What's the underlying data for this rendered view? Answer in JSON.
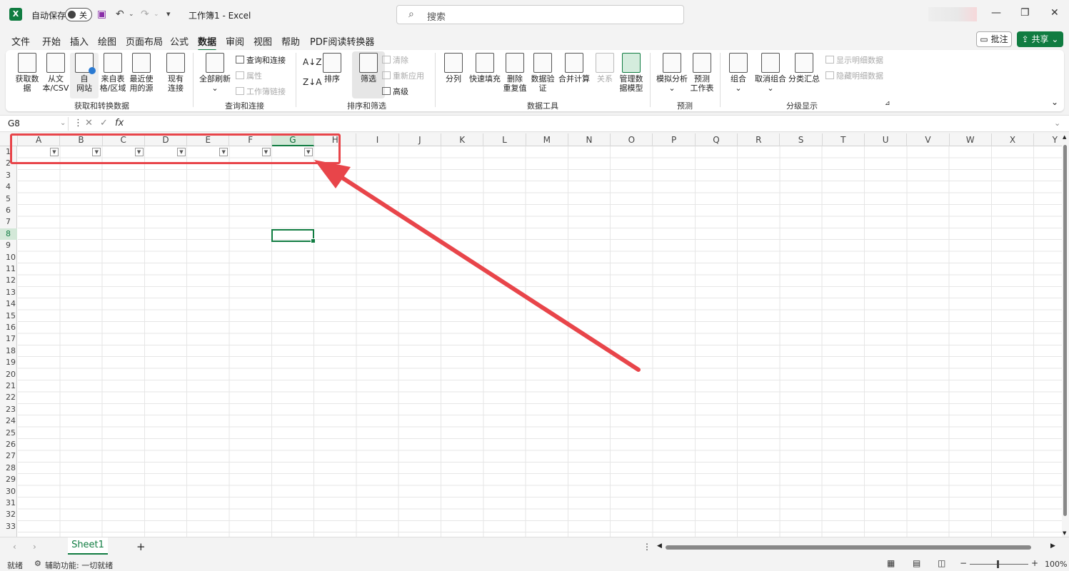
{
  "titlebar": {
    "app_logo": "X",
    "autosave_label": "自动保存",
    "autosave_state": "关",
    "doc_title": "工作簿1  -  Excel",
    "search_placeholder": "搜索",
    "icons": [
      "save-icon",
      "undo-icon",
      "redo-icon",
      "customize-icon",
      "search-icon",
      "minimize-icon",
      "restore-icon",
      "close-icon"
    ]
  },
  "menu": [
    "文件",
    "开始",
    "插入",
    "绘图",
    "页面布局",
    "公式",
    "数据",
    "审阅",
    "视图",
    "帮助",
    "PDF阅读转换器"
  ],
  "menu_active": "数据",
  "comment_label": "批注",
  "share_label": "共享",
  "ribbon": {
    "get_data": "获取数\n据",
    "from_csv": "从文\n本/CSV",
    "from_web": "自\n网站",
    "from_table": "来自表\n格/区域",
    "recent_sources": "最近使\n用的源",
    "existing_conn": "现有\n连接",
    "refresh_all": "全部刷新",
    "queries_conn": "查询和连接",
    "properties": "属性",
    "workbook_links": "工作簿链接",
    "sort": "排序",
    "filter": "筛选",
    "clear": "清除",
    "reapply": "重新应用",
    "advanced": "高级",
    "text_to_columns": "分列",
    "flash_fill": "快速填充",
    "remove_dup": "删除\n重复值",
    "data_validation": "数据验\n证",
    "consolidate": "合并计算",
    "relationships": "关系",
    "data_model": "管理数\n据模型",
    "what_if": "模拟分析",
    "forecast_sheet": "预测\n工作表",
    "group": "组合",
    "ungroup": "取消组合",
    "subtotal": "分类汇总",
    "show_detail": "显示明细数据",
    "hide_detail": "隐藏明细数据",
    "groups": {
      "get_transform": "获取和转换数据",
      "queries": "查询和连接",
      "sort_filter": "排序和筛选",
      "data_tools": "数据工具",
      "forecast": "预测",
      "outline": "分级显示"
    }
  },
  "formula_bar": {
    "name_box": "G8",
    "fx": "fx",
    "formula": ""
  },
  "columns": [
    "A",
    "B",
    "C",
    "D",
    "E",
    "F",
    "G",
    "H",
    "I",
    "J",
    "K",
    "L",
    "M",
    "N",
    "O",
    "P",
    "Q",
    "R",
    "S",
    "T",
    "U",
    "V",
    "W",
    "X",
    "Y"
  ],
  "selected_column": "G",
  "rows": [
    "1",
    "2",
    "3",
    "4",
    "5",
    "6",
    "7",
    "8",
    "9",
    "10",
    "11",
    "12",
    "13",
    "14",
    "15",
    "16",
    "17",
    "18",
    "19",
    "20",
    "21",
    "22",
    "23",
    "24",
    "25",
    "26",
    "27",
    "28",
    "29",
    "30",
    "31",
    "32",
    "33"
  ],
  "selected_row": "8",
  "sheet_tab": "Sheet1",
  "add_sheet": "+",
  "status": {
    "ready": "就绪",
    "accessibility": "辅助功能: 一切就绪",
    "zoom": "100%"
  },
  "colors": {
    "accent": "#107c41",
    "annotation": "#e8454a"
  }
}
